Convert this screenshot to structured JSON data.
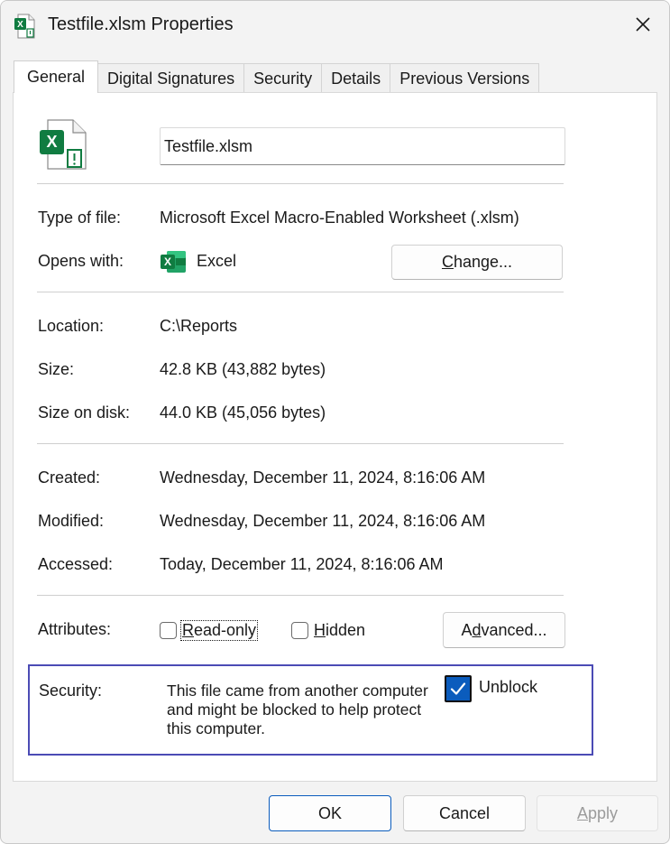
{
  "window": {
    "title": "Testfile.xlsm Properties",
    "close_symbol": "✕"
  },
  "tabs": [
    {
      "label": "General",
      "active": true
    },
    {
      "label": "Digital Signatures",
      "active": false
    },
    {
      "label": "Security",
      "active": false
    },
    {
      "label": "Details",
      "active": false
    },
    {
      "label": "Previous Versions",
      "active": false
    }
  ],
  "general": {
    "file_name": "Testfile.xlsm",
    "type_label": "Type of file:",
    "type_value": "Microsoft Excel Macro-Enabled Worksheet (.xlsm)",
    "opens_label": "Opens with:",
    "opens_value": "Excel",
    "change_button": {
      "pre": "",
      "u": "C",
      "post": "hange..."
    },
    "location_label": "Location:",
    "location_value": "C:\\Reports",
    "size_label": "Size:",
    "size_value": "42.8 KB (43,882 bytes)",
    "size_disk_label": "Size on disk:",
    "size_disk_value": "44.0 KB (45,056 bytes)",
    "created_label": "Created:",
    "created_value": "Wednesday, December 11, 2024, 8:16:06 AM",
    "modified_label": "Modified:",
    "modified_value": "Wednesday, December 11, 2024, 8:16:06 AM",
    "accessed_label": "Accessed:",
    "accessed_value": "Today, December 11, 2024, 8:16:06 AM",
    "attributes_label": "Attributes:",
    "readonly": {
      "u": "R",
      "post": "ead-only",
      "checked": false
    },
    "hidden": {
      "u": "H",
      "post": "idden",
      "checked": false
    },
    "advanced_button": {
      "pre": "A",
      "u": "d",
      "post": "vanced..."
    }
  },
  "security": {
    "label": "Security:",
    "message": "This file came from another computer and might be blocked to help protect this computer.",
    "unblock_label": "Unblock",
    "unblock_checked": true
  },
  "footer": {
    "ok": "OK",
    "cancel": "Cancel",
    "apply": {
      "u": "A",
      "post": "pply",
      "enabled": false
    }
  },
  "colors": {
    "excel_green": "#107c41",
    "accent_blue": "#0b5cbd",
    "highlight_border": "#4b4bb5"
  },
  "icons": {
    "title": "excel-macro-file-icon",
    "file": "excel-macro-file-icon",
    "opens_with": "excel-app-icon",
    "close": "close-icon",
    "unblock_check": "checkmark-icon"
  }
}
